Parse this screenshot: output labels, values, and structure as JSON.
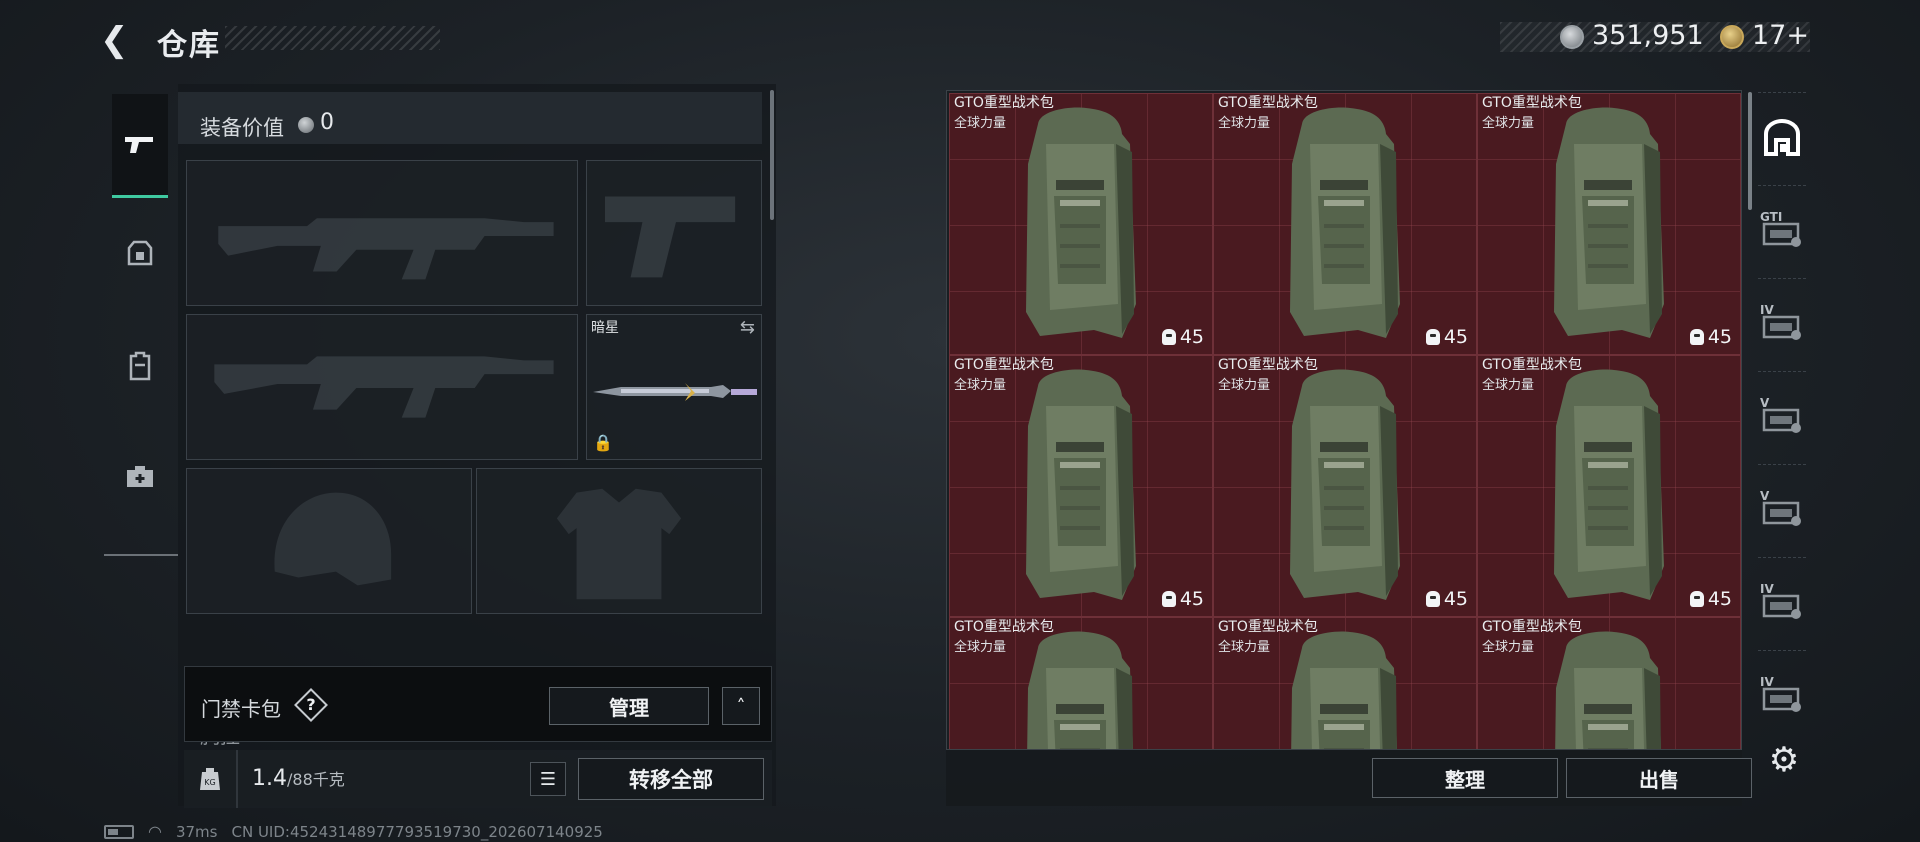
{
  "header": {
    "title": "仓库",
    "back_icon": "back-arrow-icon",
    "currency": {
      "coin_value": "351,951",
      "token_value": "17+"
    }
  },
  "left_tabs": [
    {
      "name": "tab-weapons",
      "icon": "pistol-icon",
      "active": true
    },
    {
      "name": "tab-armor",
      "icon": "armor-icon",
      "active": false
    },
    {
      "name": "tab-backpack",
      "icon": "backpack-icon",
      "active": false
    },
    {
      "name": "tab-medical",
      "icon": "medkit-icon",
      "active": false
    }
  ],
  "loadout": {
    "equip_label": "装备价值",
    "equip_value": "0",
    "knife_slot": {
      "name": "暗星"
    },
    "chest_label": "胸挂",
    "keycard": {
      "label": "门禁卡包",
      "help": "?",
      "manage_label": "管理",
      "collapse_icon": "chevron-up-icon"
    },
    "weight": {
      "current": "1.4",
      "max": "/88千克"
    },
    "transfer_label": "转移全部"
  },
  "warehouse": {
    "items": [
      {
        "name": "GTO重型战术包",
        "sub": "全球力量",
        "capacity": "45"
      },
      {
        "name": "GTO重型战术包",
        "sub": "全球力量",
        "capacity": "45"
      },
      {
        "name": "GTO重型战术包",
        "sub": "全球力量",
        "capacity": "45"
      },
      {
        "name": "GTO重型战术包",
        "sub": "全球力量",
        "capacity": "45"
      },
      {
        "name": "GTO重型战术包",
        "sub": "全球力量",
        "capacity": "45"
      },
      {
        "name": "GTO重型战术包",
        "sub": "全球力量",
        "capacity": "45"
      },
      {
        "name": "GTO重型战术包",
        "sub": "全球力量",
        "capacity": ""
      },
      {
        "name": "GTO重型战术包",
        "sub": "全球力量",
        "capacity": ""
      },
      {
        "name": "GTO重型战术包",
        "sub": "全球力量",
        "capacity": ""
      }
    ],
    "sort_label": "整理",
    "sell_label": "出售"
  },
  "right_tabs": [
    {
      "name": "tab-storage",
      "label": "",
      "icon": "storage-icon"
    },
    {
      "name": "tab-gti",
      "label": "GTI",
      "icon": "gti-icon"
    },
    {
      "name": "tab-iv-a",
      "label": "IV",
      "icon": "iv-icon"
    },
    {
      "name": "tab-v-a",
      "label": "V",
      "icon": "v-icon"
    },
    {
      "name": "tab-v-b",
      "label": "V",
      "icon": "v-icon"
    },
    {
      "name": "tab-iv-b",
      "label": "IV",
      "icon": "iv-icon"
    },
    {
      "name": "tab-iv-c",
      "label": "IV",
      "icon": "iv-icon"
    }
  ],
  "footer": {
    "ping": "37ms",
    "uid": "CN UID:4524314897779351973​0_202607140925"
  }
}
